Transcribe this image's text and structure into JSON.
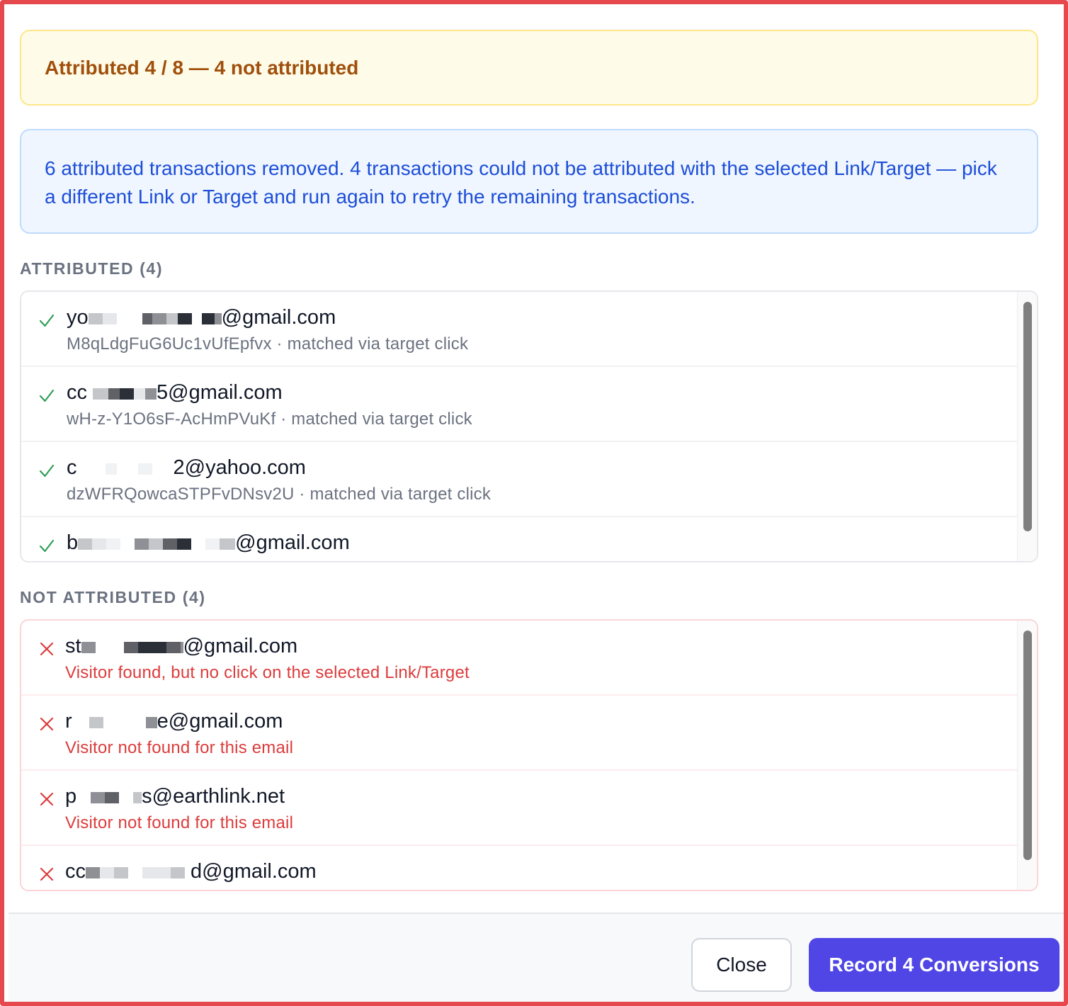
{
  "summary": {
    "text": "Attributed 4 / 8 — 4 not attributed"
  },
  "info": {
    "text": "6 attributed transactions removed. 4 transactions could not be attributed with the selected Link/Target — pick a different Link or Target and run again to retry the remaining transactions."
  },
  "attributed": {
    "title": "ATTRIBUTED (4)",
    "items": [
      {
        "email_start": "yo",
        "email_end": "@gmail.com",
        "detail": "M8qLdgFuG6Uc1vUfEpfvx · matched via target click",
        "status_icon": "check-icon"
      },
      {
        "email_start": "cc",
        "email_end": "5@gmail.com",
        "detail": "wH-z-Y1O6sF-AcHmPVuKf · matched via target click",
        "status_icon": "check-icon"
      },
      {
        "email_start": "c",
        "email_end": "2@yahoo.com",
        "detail": "dzWFRQowcaSTPFvDNsv2U · matched via target click",
        "status_icon": "check-icon"
      },
      {
        "email_start": "b",
        "email_end": "@gmail.com",
        "detail": "",
        "status_icon": "check-icon"
      }
    ]
  },
  "not_attributed": {
    "title": "NOT ATTRIBUTED (4)",
    "items": [
      {
        "email_start": "st",
        "email_end": "@gmail.com",
        "reason": "Visitor found, but no click on the selected Link/Target",
        "status_icon": "x-icon"
      },
      {
        "email_start": "r",
        "email_end": "e@gmail.com",
        "reason": "Visitor not found for this email",
        "status_icon": "x-icon"
      },
      {
        "email_start": "p",
        "email_end": "s@earthlink.net",
        "reason": "Visitor not found for this email",
        "status_icon": "x-icon"
      },
      {
        "email_start": "cc",
        "email_end": "d@gmail.com",
        "reason": "",
        "status_icon": "x-icon"
      }
    ]
  },
  "footer": {
    "close_label": "Close",
    "record_label": "Record 4 Conversions"
  },
  "colors": {
    "frame_border": "#e5484d",
    "summary_text": "#a04f0c",
    "info_text": "#1d4ed8",
    "check": "#2f9e55",
    "error": "#dc3c3c",
    "primary": "#4f46e5"
  }
}
